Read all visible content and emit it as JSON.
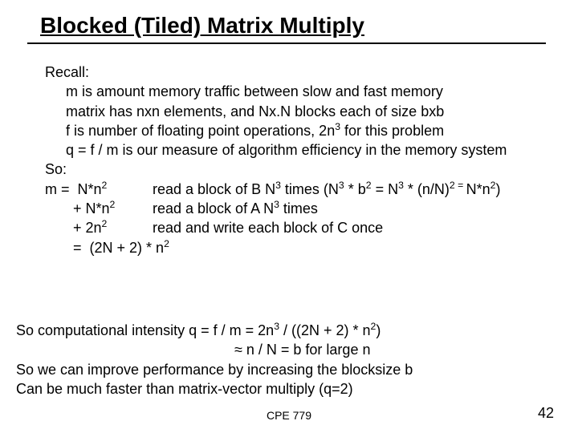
{
  "slide": {
    "title": "Blocked (Tiled) Matrix Multiply",
    "recall_heading": "Recall:",
    "recall_items": [
      "m is amount memory traffic between slow and fast memory",
      "matrix has nxn elements, and Nx.N blocks each of size bxb"
    ],
    "recall_f_pre": "f is number of floating point operations, 2n",
    "recall_f_exp": "3",
    "recall_f_post": " for this problem",
    "recall_q": "q = f / m is our measure of algorithm efficiency in the memory system",
    "so_heading": "So:",
    "m_label": "m =  N*n",
    "m_label_exp": "2",
    "m1_pre": "read a block of B  N",
    "m1_e1": "3",
    "m1_mid1": " times (N",
    "m1_e2": "3",
    "m1_mid2": " * b",
    "m1_e3": "2",
    "m1_mid3": " = N",
    "m1_e4": "3",
    "m1_mid4": " * (n/N)",
    "m1_e5": "2 = ",
    "m1_mid5": "N*n",
    "m1_e6": "2",
    "m1_end": ")",
    "m2_label_pre": "       + N*n",
    "m2_label_exp": "2",
    "m2_pre": "read a block of A  N",
    "m2_exp": "3",
    "m2_post": " times",
    "m3_label_pre": "       + 2n",
    "m3_label_exp": "2",
    "m3_text": "read and write each block of C once",
    "m4_label": "       =  (2N + 2) * n",
    "m4_exp": "2",
    "bottom_q_pre": "So computational intensity q = f / m = 2n",
    "bottom_q_e1": "3",
    "bottom_q_mid": " / ((2N + 2) * n",
    "bottom_q_e2": "2",
    "bottom_q_end": ")",
    "bottom_approx": "≈ n / N = b   for large n",
    "bottom_line3": "So we can improve performance by increasing the blocksize b",
    "bottom_line4": "Can be much faster than matrix-vector multiply (q=2)",
    "footer_center": "CPE 779",
    "footer_right": "42"
  }
}
